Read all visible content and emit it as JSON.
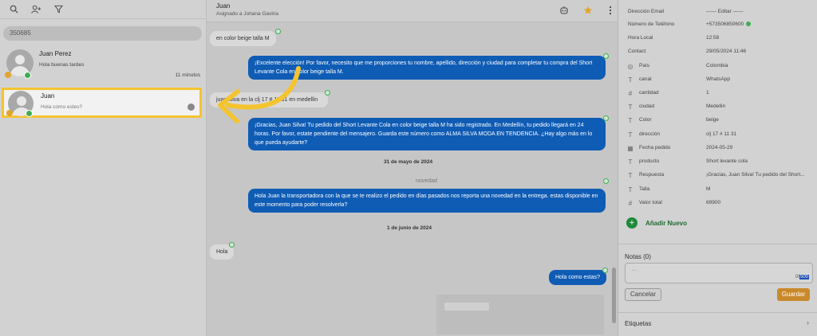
{
  "sidebar": {
    "search_value": "350685",
    "contacts": [
      {
        "name": "Juan Perez",
        "preview": "Hola buenas tardes",
        "time": "11 minutos"
      },
      {
        "name": "Juan",
        "preview": "Hola como estes?"
      }
    ]
  },
  "chat": {
    "contact_name": "Juan",
    "assigned": "Asignado a Johana Gaviria",
    "messages": [
      {
        "dir": "in",
        "text": "en color beige talla M"
      },
      {
        "dir": "out",
        "text": "¡Excelente elección! Por favor, necesito que me proporciones tu nombre, apellido, dirección y ciudad para completar tu compra del Short Levante Cola en color beige talla M."
      },
      {
        "dir": "in",
        "text": "juan silva en la clj 17 # 11 31 en medellin"
      },
      {
        "dir": "out",
        "text": "¡Gracias, Juan Silva! Tu pedido del Short Levante Cola en color beige talla M ha sido registrado. En Medellín, tu pedido llegará en 24 horas. Por favor, estate pendiente del mensajero. Guarda este número como ALMA SILVA MODA EN TENDENCIA. ¿Hay algo más en lo que pueda ayudarte?"
      },
      {
        "dir": "sep",
        "text": "31 de mayo de 2024"
      },
      {
        "dir": "label",
        "text": "novedad"
      },
      {
        "dir": "out",
        "text": "Hola Juan la transportadora con la que se te realizo el pedido en días pasados nos reporta una novedad en la entrega. estas disponible en este momento para poder resolverla?"
      },
      {
        "dir": "sep",
        "text": "1 de junio de 2024"
      },
      {
        "dir": "in",
        "text": "Hola"
      },
      {
        "dir": "out",
        "text": "Hola como estas?"
      }
    ]
  },
  "details": {
    "rows": [
      {
        "key": "Dirección Email",
        "value": "------ Editar ------"
      },
      {
        "key": "Número de Teléfono",
        "value": "+573506850600"
      },
      {
        "key": "Hora Local",
        "value": "12:58"
      },
      {
        "key": "Contact",
        "value": "29/05/2024 11:46"
      },
      {
        "key": "País",
        "value": "Colombia"
      },
      {
        "key": "canal",
        "value": "WhatsApp"
      },
      {
        "key": "cantidad",
        "value": "1"
      },
      {
        "key": "ciudad",
        "value": "Medellin"
      },
      {
        "key": "Color",
        "value": "beige"
      },
      {
        "key": "dirección",
        "value": "clj 17 # 11 31"
      },
      {
        "key": "Fecha pedido",
        "value": "2024-05-29"
      },
      {
        "key": "producto",
        "value": "Short levante cola"
      },
      {
        "key": "Respuesta",
        "value": "¡Gracias, Juan Silva! Tu pedido del Short..."
      },
      {
        "key": "Talla",
        "value": "M"
      },
      {
        "key": "Valor total",
        "value": "69900"
      }
    ],
    "add_new": "Añadir Nuevo",
    "notes_label": "Notas (0)",
    "notes_placeholder": "...",
    "notes_counter_prefix": "0/",
    "notes_counter_max": "500",
    "cancel": "Cancelar",
    "save": "Guardar",
    "tags": "Etiquetas"
  },
  "colors": {
    "accent_yellow": "#f4c430",
    "outgoing_bubble": "#0f5cb5",
    "save_button": "#c9892b",
    "whatsapp_green": "#3fae52"
  }
}
